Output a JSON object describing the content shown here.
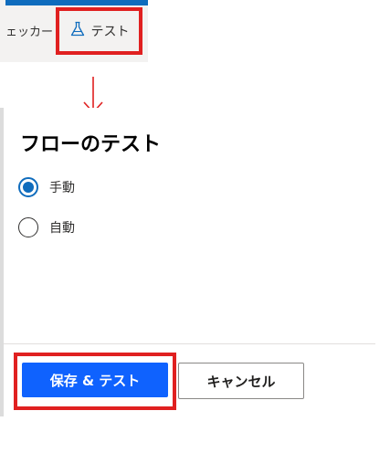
{
  "toolbar": {
    "checker_label": "ェッカー",
    "test_tab_label": "テスト",
    "test_tab_icon": "flask-icon"
  },
  "panel": {
    "title": "フローのテスト",
    "options": [
      {
        "label": "手動",
        "selected": true
      },
      {
        "label": "自動",
        "selected": false
      }
    ],
    "save_label": "保存 & テスト",
    "cancel_label": "キャンセル"
  },
  "colors": {
    "accent": "#0f6cbd",
    "primary_button": "#0f62fe",
    "highlight": "#e02020"
  }
}
